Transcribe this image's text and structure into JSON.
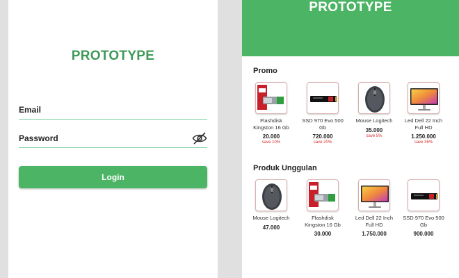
{
  "login": {
    "title": "PROTOTYPE",
    "email_placeholder": "Email",
    "password_placeholder": "Password",
    "toggle_visibility_icon": "eye-off-icon",
    "login_label": "Login",
    "accent": "#4cb465",
    "title_color": "#3f9a58",
    "underline_color": "#74cfa0"
  },
  "home": {
    "title": "PROTOTYPE",
    "header_color": "#4cb465",
    "promo_title": "Promo",
    "promo": [
      {
        "name": "Flashdisk Kingston 16 Gb",
        "price": "20.000",
        "save": "save 10%",
        "icon": "flashdisk-image"
      },
      {
        "name": "SSD 970 Evo 500 Gb",
        "price": "720.000",
        "save": "save 20%",
        "icon": "ssd-image"
      },
      {
        "name": "Mouse Logitech",
        "price": "35.000",
        "save": "save 5%",
        "icon": "mouse-image"
      },
      {
        "name": "Led Dell 22 Inch Full HD",
        "price": "1.250.000",
        "save": "save 35%",
        "icon": "monitor-image"
      }
    ],
    "featured_title": "Produk Unggulan",
    "featured": [
      {
        "name": "Mouse Logitech",
        "price": "47.000",
        "icon": "mouse-image"
      },
      {
        "name": "Flashdisk Kingston 16 Gb",
        "price": "30.000",
        "icon": "flashdisk-image"
      },
      {
        "name": "Led Dell 22 Inch Full HD",
        "price": "1.750.000",
        "icon": "monitor-image"
      },
      {
        "name": "SSD 970 Evo 500 Gb",
        "price": "900.000",
        "icon": "ssd-image"
      }
    ]
  }
}
